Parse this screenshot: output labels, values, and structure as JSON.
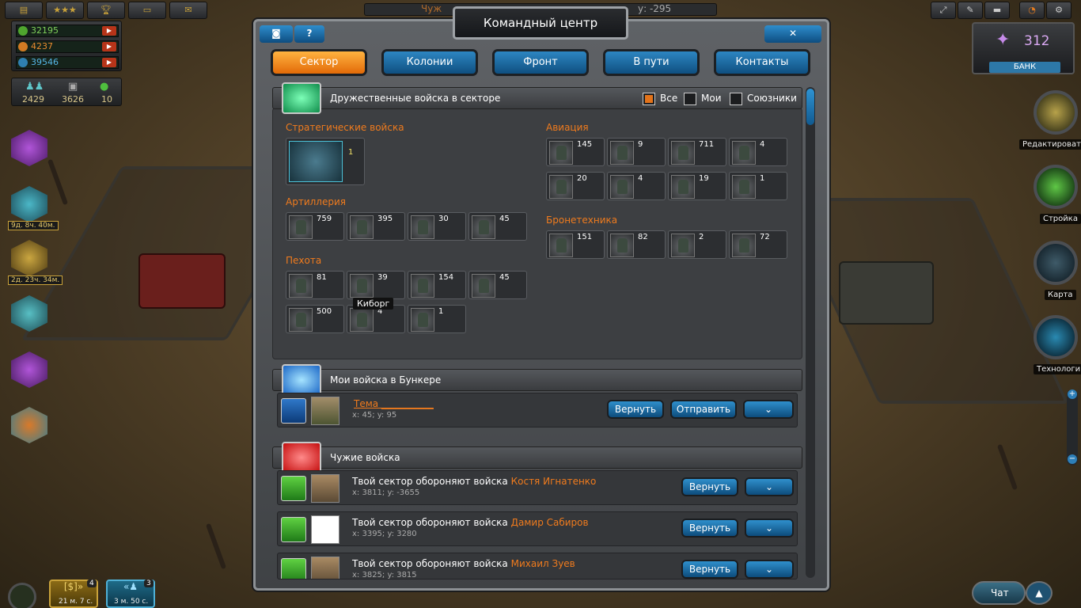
{
  "top_hud": {
    "top_right_text": "Чуж",
    "coord_text": "у: -295",
    "resources": [
      {
        "value": "32195",
        "color": "#7fd05a"
      },
      {
        "value": "4237",
        "color": "#e98a2e"
      },
      {
        "value": "39546",
        "color": "#56b6e6"
      }
    ],
    "stats": [
      "2429",
      "3626",
      "10"
    ],
    "timers": [
      "9д. 8ч. 40м.",
      "2д. 23ч. 34м."
    ],
    "bottom_badges": [
      {
        "count": "4",
        "time": "21 м. 7 с."
      },
      {
        "count": "3",
        "time": "3 м. 50 с."
      }
    ]
  },
  "bank": {
    "value": "312",
    "label": "БАНК"
  },
  "side_buttons": [
    "Редактировать",
    "Стройка",
    "Карта",
    "Технологии"
  ],
  "chat_label": "Чат",
  "dialog": {
    "title": "Командный центр",
    "help": "?",
    "close": "✕",
    "tabs": [
      "Сектор",
      "Колонии",
      "Фронт",
      "В пути",
      "Контакты"
    ]
  },
  "friendly": {
    "header": "Дружественные войска в секторе",
    "filters": [
      {
        "label": "Все",
        "checked": true
      },
      {
        "label": "Мои",
        "checked": false
      },
      {
        "label": "Союзники",
        "checked": false
      }
    ],
    "categories": {
      "strategic": {
        "label": "Стратегические войска",
        "units": [
          "1"
        ]
      },
      "artillery": {
        "label": "Артиллерия",
        "units": [
          "759",
          "395",
          "30",
          "45"
        ]
      },
      "infantry": {
        "label": "Пехота",
        "units": [
          "81",
          "39",
          "154",
          "45",
          "500",
          "4",
          "1"
        ]
      },
      "aviation": {
        "label": "Авиация",
        "units": [
          "145",
          "9",
          "711",
          "4",
          "20",
          "4",
          "19",
          "1"
        ]
      },
      "armor": {
        "label": "Бронетехника",
        "units": [
          "151",
          "82",
          "2",
          "72"
        ]
      }
    },
    "tooltip": "Киборг"
  },
  "bunker": {
    "header": "Мои войска в Бункере",
    "name": "Тема ___________",
    "coords": "x: 45; y: 95",
    "return": "Вернуть",
    "send": "Отправить",
    "expand": "⌄"
  },
  "foreign": {
    "header": "Чужие войска",
    "prefix": "Твой сектор обороняют войска",
    "return": "Вернуть",
    "rows": [
      {
        "name": "Костя Игнатенко",
        "coords": "x: 3811; y: -3655"
      },
      {
        "name": "Дамир Сабиров",
        "coords": "x: 3395; y: 3280"
      },
      {
        "name": "Михаил Зуев",
        "coords": "x: 3825; y: 3815"
      }
    ]
  }
}
